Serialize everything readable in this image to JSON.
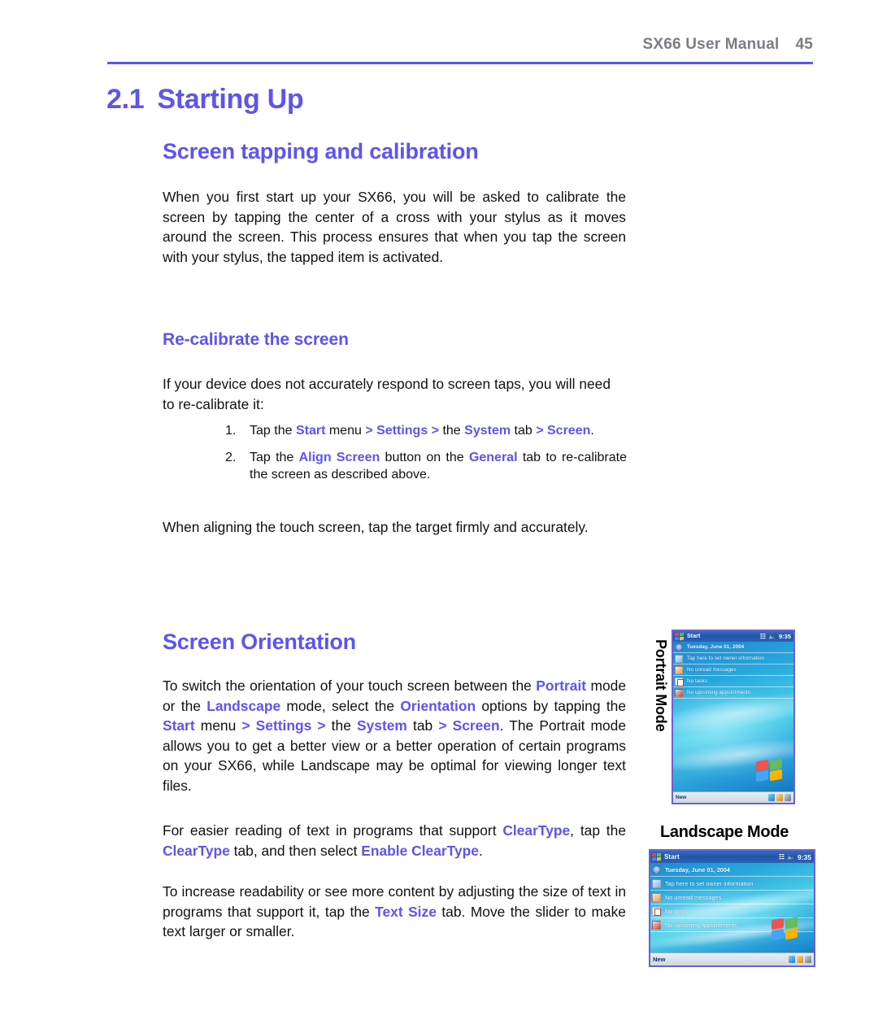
{
  "header": {
    "manual_title": "SX66 User Manual",
    "page_number": "45",
    "rule_color": "#5c55ee"
  },
  "colors": {
    "heading": "#5c55ee",
    "keyword": "#5c55ee",
    "header_text": "#7c7c84",
    "body": "#111111"
  },
  "chapter": {
    "number": "2.1",
    "title": "Starting Up"
  },
  "sections": {
    "screen_tapping_heading": "Screen tapping and calibration",
    "intro_paragraph": "When you first start up your SX66, you will be asked to calibrate the screen by tapping the center of a cross with your stylus as it moves around the screen. This process ensures that when you tap the screen with your stylus, the tapped item is activated.",
    "recalibrate_heading": "Re-calibrate the screen",
    "recalibrate_intro": "If your device does not accurately respond to screen taps, you will need to re-calibrate it:",
    "steps": [
      {
        "number": "1.",
        "parts": [
          {
            "text": "Tap the ",
            "emph": false
          },
          {
            "text": "Start",
            "emph": true
          },
          {
            "text": " menu ",
            "emph": false
          },
          {
            "text": "> Settings >",
            "emph": true
          },
          {
            "text": " the ",
            "emph": false
          },
          {
            "text": "System",
            "emph": true
          },
          {
            "text": " tab ",
            "emph": false
          },
          {
            "text": "> Screen",
            "emph": true
          },
          {
            "text": ".",
            "emph": false
          }
        ]
      },
      {
        "number": "2.",
        "parts": [
          {
            "text": "Tap the ",
            "emph": false
          },
          {
            "text": "Align Screen",
            "emph": true
          },
          {
            "text": " button on the ",
            "emph": false
          },
          {
            "text": "General",
            "emph": true
          },
          {
            "text": " tab to re-calibrate the screen as described above.",
            "emph": false
          }
        ]
      }
    ],
    "aligning_note": "When aligning the touch screen, tap the target firmly and accurately.",
    "screen_orientation_heading": "Screen Orientation",
    "orientation_paragraph_parts": [
      {
        "text": "To switch the orientation of your touch screen between the ",
        "emph": false
      },
      {
        "text": "Portrait",
        "emph": true
      },
      {
        "text": " mode or the ",
        "emph": false
      },
      {
        "text": "Landscape",
        "emph": true
      },
      {
        "text": " mode, select the ",
        "emph": false
      },
      {
        "text": "Orientation",
        "emph": true
      },
      {
        "text": " options by tapping the ",
        "emph": false
      },
      {
        "text": "Start",
        "emph": true
      },
      {
        "text": " menu ",
        "emph": false
      },
      {
        "text": "> Settings >",
        "emph": true
      },
      {
        "text": " the ",
        "emph": false
      },
      {
        "text": "System",
        "emph": true
      },
      {
        "text": " tab ",
        "emph": false
      },
      {
        "text": "> Screen",
        "emph": true
      },
      {
        "text": ". The Portrait mode allows you to get a better view or a better operation of certain programs on your SX66, while Landscape may be optimal for viewing longer text files.",
        "emph": false
      }
    ],
    "cleartype_paragraph_parts": [
      {
        "text": "For easier reading of text in programs that support ",
        "emph": false
      },
      {
        "text": "ClearType",
        "emph": true
      },
      {
        "text": ", tap the ",
        "emph": false
      },
      {
        "text": "ClearType",
        "emph": true
      },
      {
        "text": " tab, and then select ",
        "emph": false
      },
      {
        "text": "Enable ClearType",
        "emph": true
      },
      {
        "text": ".",
        "emph": false
      }
    ],
    "textsize_paragraph_parts": [
      {
        "text": "To increase readability or see more content by adjusting the size of text in programs that support it, tap the ",
        "emph": false
      },
      {
        "text": "Text Size",
        "emph": true
      },
      {
        "text": " tab. Move the slider to make text larger or smaller.",
        "emph": false
      }
    ]
  },
  "figures": {
    "portrait_label": "Portrait Mode",
    "landscape_label": "Landscape Mode",
    "pda_screen": {
      "start_label": "Start",
      "clock": "9:35",
      "new_label": "New",
      "rows": [
        {
          "icon": "clock-icon",
          "text": "Tuesday, June 01, 2004"
        },
        {
          "icon": "owner-info-icon",
          "text": "Tap here to set owner information"
        },
        {
          "icon": "mail-icon",
          "text": "No unread messages"
        },
        {
          "icon": "tasks-icon",
          "text": "No tasks"
        },
        {
          "icon": "calendar-icon",
          "text": "No upcoming appointments"
        }
      ]
    }
  }
}
